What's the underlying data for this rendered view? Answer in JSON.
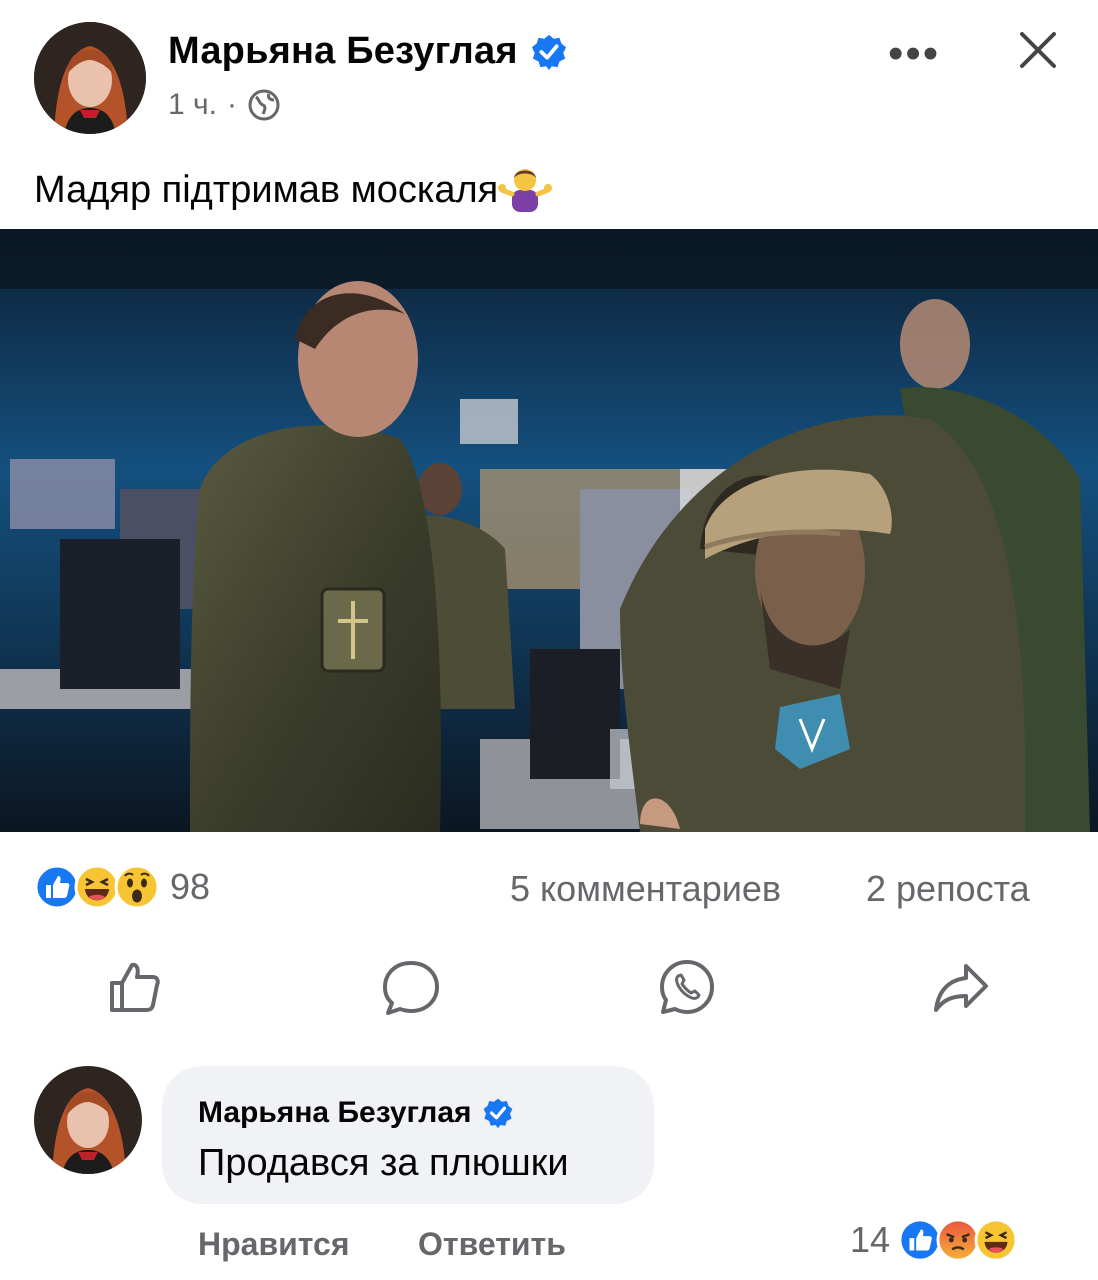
{
  "post": {
    "author": "Марьяна Безуглая",
    "time": "1 ч.",
    "separator": "·",
    "text": "Мадяр підтримав москаля",
    "text_emoji_icon": "person-shrugging-emoji",
    "more_label": "•••",
    "photo_alt_icon": "military-command-room-photo"
  },
  "stats": {
    "reaction_icons": [
      "like-reaction-icon",
      "haha-reaction-icon",
      "wow-reaction-icon"
    ],
    "reaction_count": "98",
    "comments": "5 комментариев",
    "shares": "2 репоста"
  },
  "actions": [
    "like-action-icon",
    "comment-action-icon",
    "whatsapp-action-icon",
    "share-action-icon"
  ],
  "comment": {
    "author": "Марьяна Безуглая",
    "text": "Продався за плюшки",
    "like_label": "Нравится",
    "reply_label": "Ответить",
    "reaction_count": "14",
    "reaction_icons": [
      "like-reaction-icon",
      "angry-reaction-icon",
      "haha-reaction-icon"
    ]
  },
  "colors": {
    "brand_blue": "#1877f2",
    "secondary_text": "#65676b",
    "bubble_bg": "#f0f2f5"
  }
}
